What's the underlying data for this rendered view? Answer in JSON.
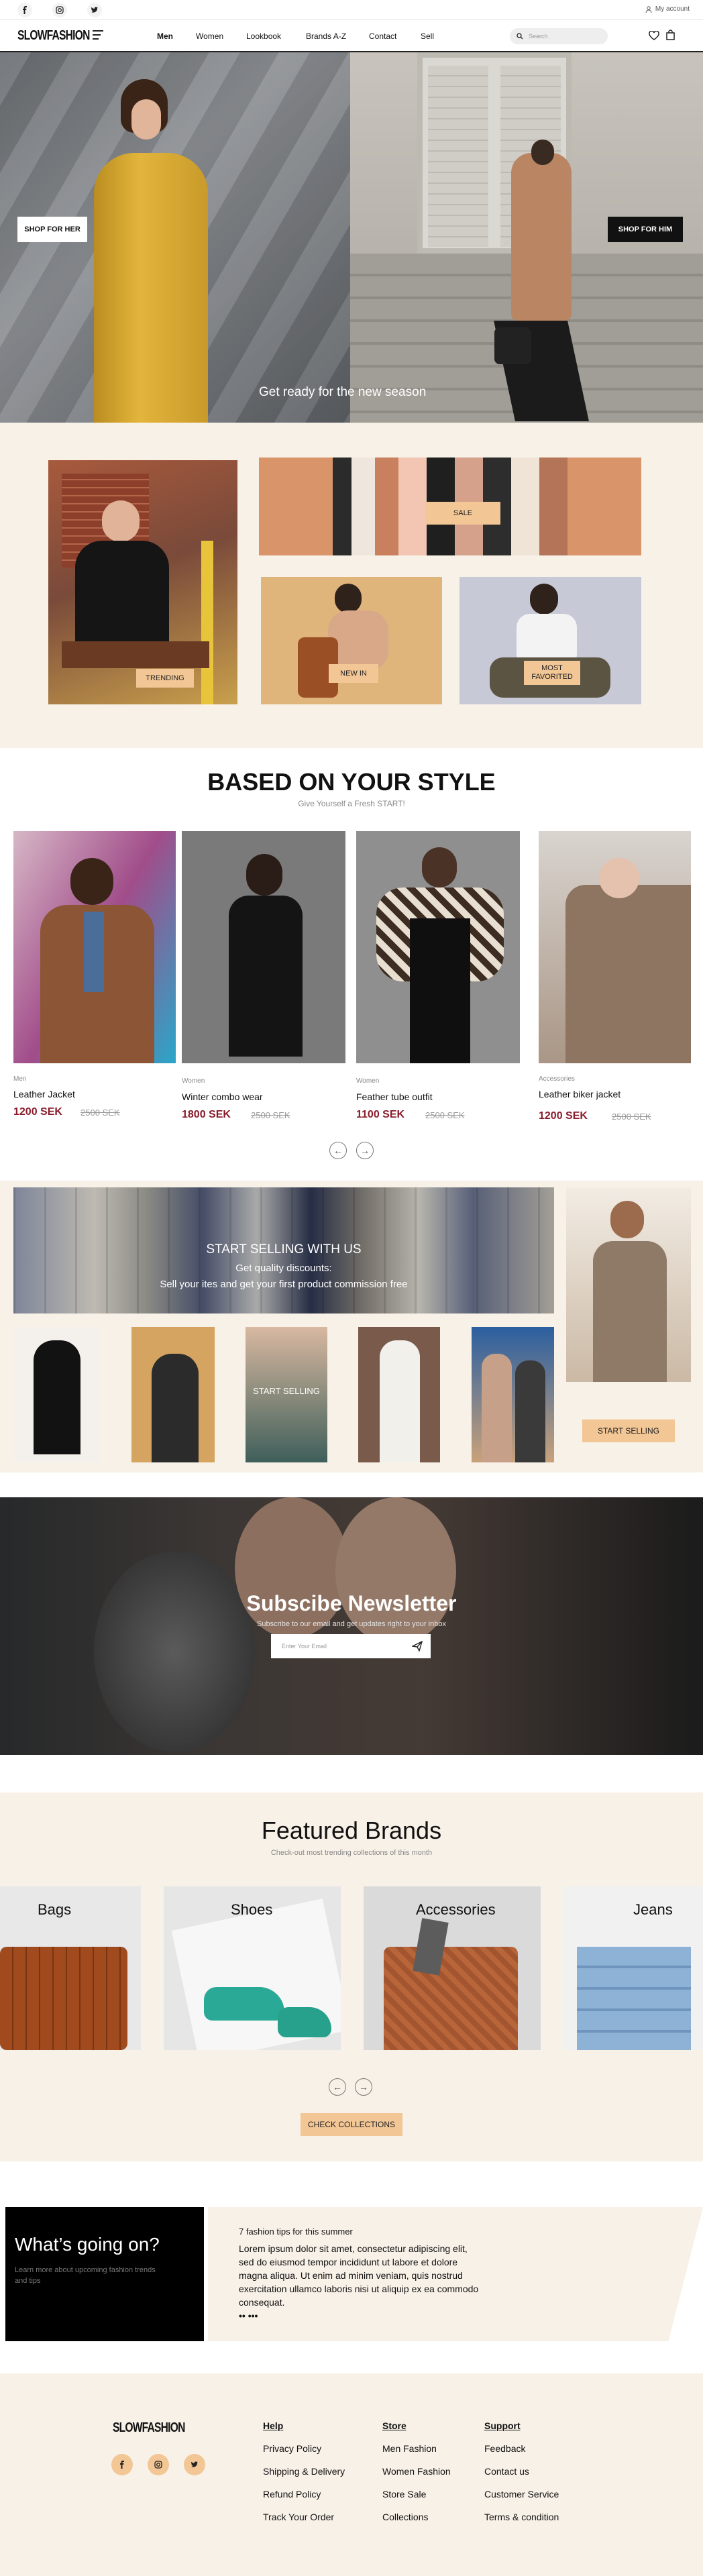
{
  "topbar": {
    "account_label": "My account"
  },
  "nav": {
    "logo": "SLOWFASHION",
    "links": [
      "Men",
      "Women",
      "Lookbook",
      "Brands A-Z",
      "Contact",
      "Sell"
    ],
    "search_placeholder": "Search"
  },
  "hero": {
    "left_button": "SHOP FOR HER",
    "right_button": "SHOP FOR HIM",
    "caption": "Get ready for the new season"
  },
  "categories": {
    "trending": "TRENDING",
    "sale": "SALE",
    "new_in": "NEW IN",
    "most_favorited": "MOST FAVORITED"
  },
  "style": {
    "title": "BASED ON YOUR STYLE",
    "subtitle": "Give Yourself a Fresh START!",
    "products": [
      {
        "category": "Men",
        "name": "Leather  Jacket",
        "price": "1200 SEK",
        "old": "2500 SEK"
      },
      {
        "category": "Women",
        "name": "Winter combo wear",
        "price": "1800 SEK",
        "old": "2500 SEK"
      },
      {
        "category": "Women",
        "name": "Feather tube outfit",
        "price": "1100 SEK",
        "old": "2500 SEK"
      },
      {
        "category": "Accessories",
        "name": "Leather biker jacket",
        "price": "1200 SEK",
        "old": "2500 SEK"
      }
    ]
  },
  "sell": {
    "title": "START SELLING WITH US",
    "discounts": "Get quality discounts:",
    "body": "Sell your ites and get your first product commission free",
    "overlay": "START SELLING",
    "button": "START SELLING"
  },
  "newsletter": {
    "title": "Subscibe Newsletter",
    "subtitle": "Subscribe to our email and get updates right to your inbox",
    "placeholder": "Enter Your Email"
  },
  "brands": {
    "title": "Featured Brands",
    "subtitle": "Check-out most trending collections of this month",
    "items": [
      "Bags",
      "Shoes",
      "Accessories",
      "Jeans"
    ],
    "button": "CHECK COLLECTIONS"
  },
  "blog": {
    "title": "What’s going on?",
    "subtitle": "Learn more about upcoming fashion trends and tips",
    "post_title": "7 fashion tips for this summer",
    "post_body": "Lorem ipsum dolor sit amet, consectetur adipiscing elit, sed do eiusmod tempor incididunt ut labore et dolore magna aliqua. Ut enim ad minim veniam, quis nostrud exercitation ullamco laboris nisi ut aliquip ex ea commodo consequat.",
    "more": "•• •••"
  },
  "footer": {
    "logo": "SLOWFASHION",
    "columns": [
      {
        "head": "Help",
        "links": [
          "Privacy Policy",
          "Shipping & Delivery",
          "Refund Policy",
          "Track Your Order"
        ]
      },
      {
        "head": "Store",
        "links": [
          "Men Fashion",
          "Women Fashion",
          "Store Sale",
          "Collections"
        ]
      },
      {
        "head": "Support",
        "links": [
          "Feedback",
          "Contact us",
          "Customer Service",
          "Terms & condition"
        ]
      }
    ]
  },
  "colors": {
    "accent": "#f2c695",
    "price": "#8a1b2b",
    "cream": "#f8f1e8"
  }
}
